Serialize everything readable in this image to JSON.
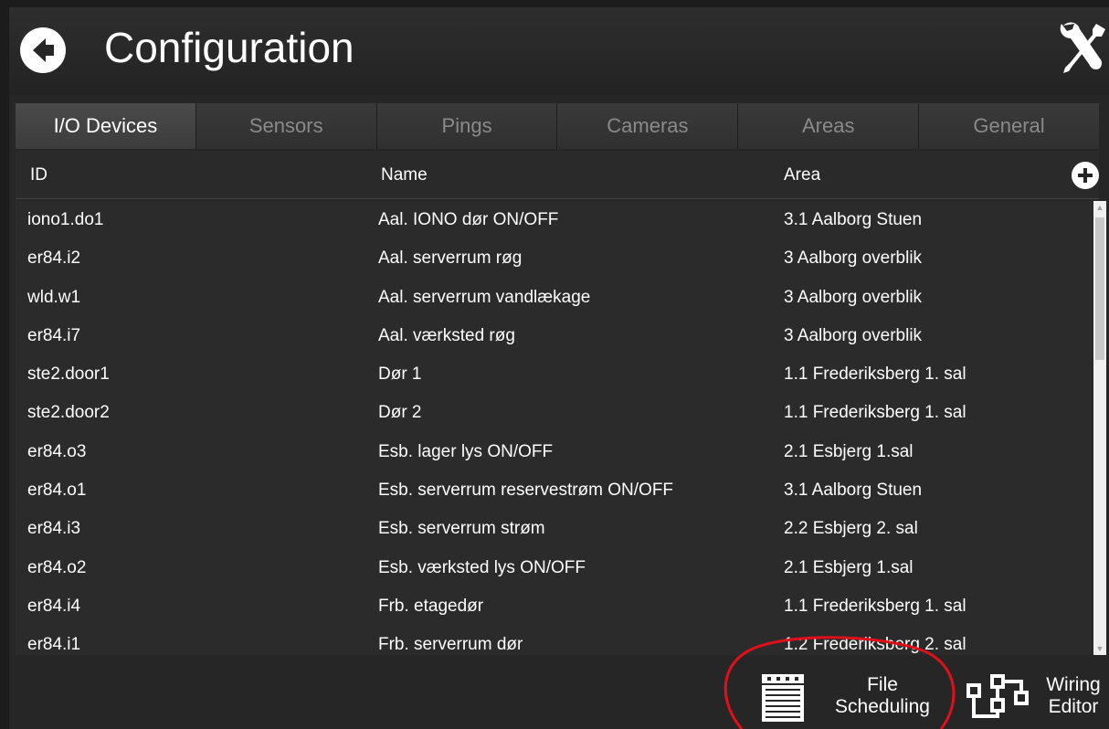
{
  "header": {
    "title": "Configuration",
    "back_icon": "back-arrow-icon",
    "tools_icon": "tools-icon"
  },
  "tabs": [
    {
      "label": "I/O Devices",
      "active": true
    },
    {
      "label": "Sensors",
      "active": false
    },
    {
      "label": "Pings",
      "active": false
    },
    {
      "label": "Cameras",
      "active": false
    },
    {
      "label": "Areas",
      "active": false
    },
    {
      "label": "General",
      "active": false
    }
  ],
  "table": {
    "columns": {
      "id": "ID",
      "name": "Name",
      "area": "Area"
    },
    "add_icon": "plus-icon",
    "rows": [
      {
        "id": "iono1.do1",
        "name": "Aal. IONO dør ON/OFF",
        "area": "3.1 Aalborg Stuen"
      },
      {
        "id": "er84.i2",
        "name": "Aal. serverrum røg",
        "area": "3 Aalborg overblik"
      },
      {
        "id": "wld.w1",
        "name": "Aal. serverrum vandlækage",
        "area": "3 Aalborg overblik"
      },
      {
        "id": "er84.i7",
        "name": "Aal. værksted røg",
        "area": "3 Aalborg overblik"
      },
      {
        "id": "ste2.door1",
        "name": "Dør 1",
        "area": "1.1 Frederiksberg 1. sal"
      },
      {
        "id": "ste2.door2",
        "name": "Dør 2",
        "area": "1.1 Frederiksberg 1. sal"
      },
      {
        "id": "er84.o3",
        "name": "Esb. lager lys ON/OFF",
        "area": "2.1 Esbjerg 1.sal"
      },
      {
        "id": "er84.o1",
        "name": "Esb. serverrum reservestrøm ON/OFF",
        "area": "3.1 Aalborg Stuen"
      },
      {
        "id": "er84.i3",
        "name": "Esb. serverrum strøm",
        "area": "2.2 Esbjerg 2. sal"
      },
      {
        "id": "er84.o2",
        "name": "Esb. værksted lys ON/OFF",
        "area": "2.1 Esbjerg 1.sal"
      },
      {
        "id": "er84.i4",
        "name": "Frb. etagedør",
        "area": "1.1 Frederiksberg 1. sal"
      },
      {
        "id": "er84.i1",
        "name": "Frb. serverrum dør",
        "area": "1.2 Frederiksberg 2. sal"
      }
    ]
  },
  "footer": {
    "file_scheduling": {
      "line1": "File",
      "line2": "Scheduling",
      "icon": "document-list-icon"
    },
    "wiring_editor": {
      "line1": "Wiring",
      "line2": "Editor",
      "icon": "wiring-diagram-icon"
    }
  },
  "colors": {
    "background": "#262626",
    "header": "#2e2e2e",
    "annotation_circle": "#e0101a",
    "tab_inactive_text": "#8a8a8a"
  }
}
